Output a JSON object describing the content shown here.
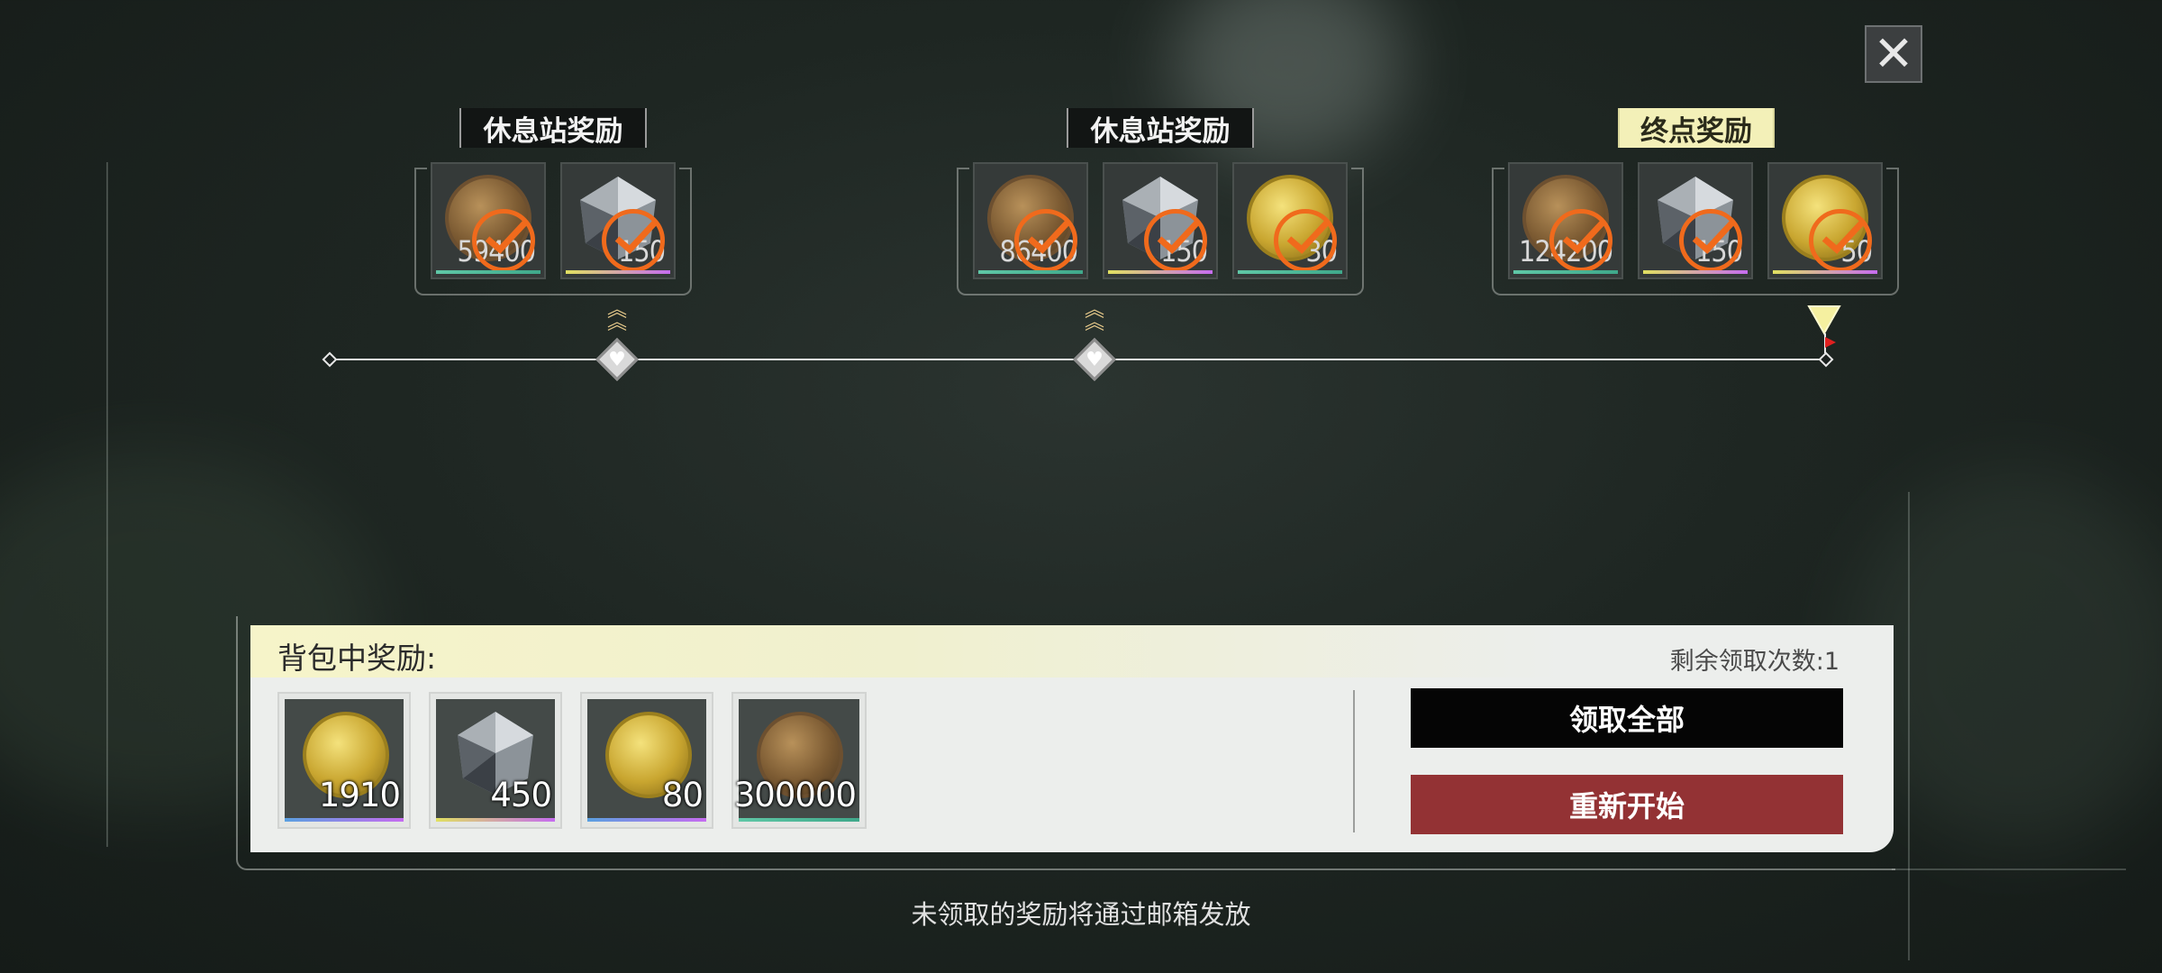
{
  "close_icon": "close-icon",
  "stations": [
    {
      "label": "休息站奖励",
      "final": false,
      "rewards": [
        {
          "icon": "bronze-n-coin-icon",
          "qty": "59400",
          "claimed": true,
          "bar": "#5fc7a6"
        },
        {
          "icon": "silver-gem-icon",
          "qty": "150",
          "claimed": true,
          "bar": "#c66cf0"
        }
      ]
    },
    {
      "label": "休息站奖励",
      "final": false,
      "rewards": [
        {
          "icon": "bronze-n-coin-icon",
          "qty": "86400",
          "claimed": true,
          "bar": "#5fc7a6"
        },
        {
          "icon": "silver-gem-icon",
          "qty": "150",
          "claimed": true,
          "bar": "#c66cf0"
        },
        {
          "icon": "gold-music-coin-icon",
          "qty": "30",
          "claimed": true,
          "bar": "#5fc7a6"
        }
      ]
    },
    {
      "label": "终点奖励",
      "final": true,
      "rewards": [
        {
          "icon": "bronze-n-coin-icon",
          "qty": "124200",
          "claimed": true,
          "bar": "#5fc7a6"
        },
        {
          "icon": "silver-gem-icon",
          "qty": "150",
          "claimed": true,
          "bar": "#c66cf0"
        },
        {
          "icon": "gold-music-coin-icon",
          "qty": "50",
          "claimed": true,
          "bar": "#c66cf0"
        }
      ]
    }
  ],
  "bag": {
    "title": "背包中奖励:",
    "remaining": "剩余领取次数:1",
    "items": [
      {
        "icon": "gold-backpack-coin-icon",
        "qty": "1910"
      },
      {
        "icon": "silver-gem-icon",
        "qty": "450"
      },
      {
        "icon": "gold-music-coin-icon",
        "qty": "80"
      },
      {
        "icon": "bronze-n-coin-icon",
        "qty": "300000"
      }
    ],
    "claim_all": "领取全部",
    "restart": "重新开始"
  },
  "footer_note": "未领取的奖励将通过邮箱发放",
  "colors": {
    "check": "#f06a1c",
    "restart": "#933234",
    "final_label": "#f3f0b8"
  }
}
